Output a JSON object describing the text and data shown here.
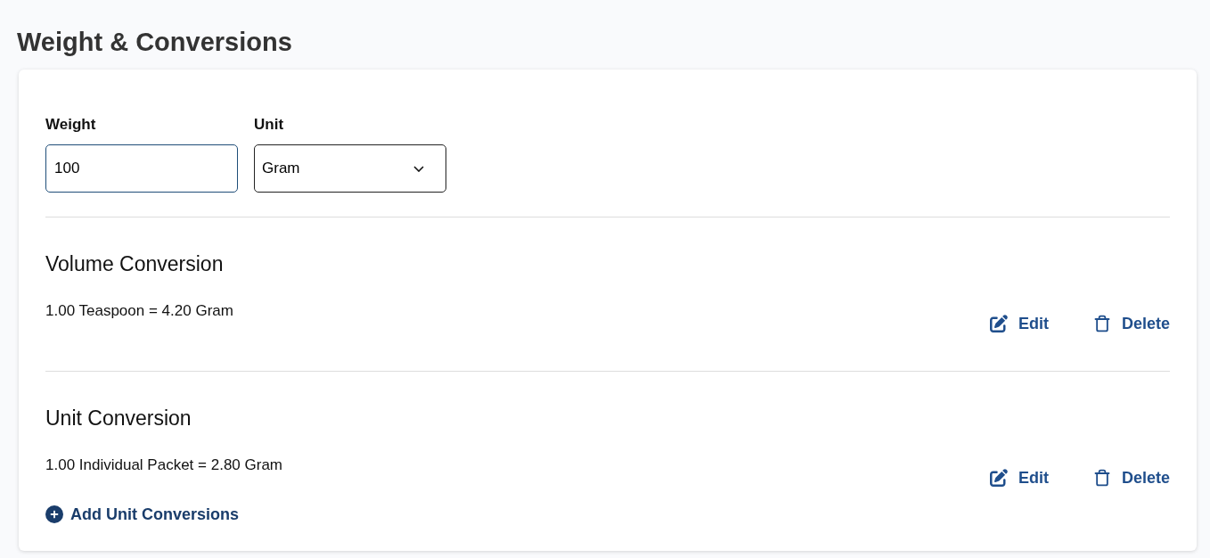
{
  "page": {
    "title": "Weight & Conversions"
  },
  "weight": {
    "label": "Weight",
    "value": "100",
    "focused": true
  },
  "unit": {
    "label": "Unit",
    "value": "Gram"
  },
  "sections": [
    {
      "title": "Volume Conversion",
      "rows": [
        {
          "text": "1.00 Teaspoon = 4.20 Gram",
          "actions": [
            {
              "kind": "edit",
              "label": "Edit"
            },
            {
              "kind": "delete",
              "label": "Delete"
            }
          ]
        }
      ]
    },
    {
      "title": "Unit Conversion",
      "rows": [
        {
          "text": "1.00 Individual Packet = 2.80 Gram",
          "actions": [
            {
              "kind": "edit",
              "label": "Edit"
            },
            {
              "kind": "delete",
              "label": "Delete"
            }
          ]
        }
      ],
      "add_link": "Add Unit Conversions"
    }
  ]
}
